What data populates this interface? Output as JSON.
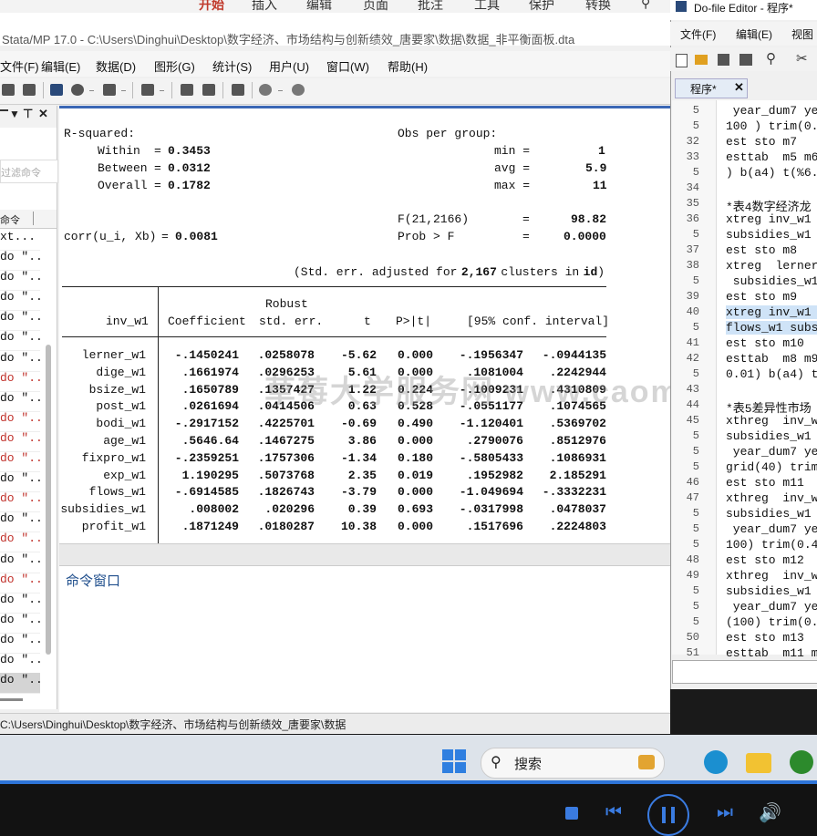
{
  "ribbon": {
    "items": [
      "开始",
      "插入",
      "编辑",
      "页面",
      "批注",
      "工具",
      "保护",
      "转换"
    ]
  },
  "stata": {
    "title": "Stata/MP 17.0 - C:\\Users\\Dinghui\\Desktop\\数字经济、市场结构与创新绩效_唐要家\\数据\\数据_非平衡面板.dta",
    "menu": [
      "文件(F)",
      "编辑(E)",
      "数据(D)",
      "图形(G)",
      "统计(S)",
      "用户(U)",
      "窗口(W)",
      "帮助(H)"
    ],
    "left_pane": {
      "filter_placeholder": "过滤命令",
      "col_header": "命令",
      "first_row": "xt...",
      "rows": [
        {
          "text": "do \"...",
          "color": "black"
        },
        {
          "text": "do \"...",
          "color": "black"
        },
        {
          "text": "do \"...",
          "color": "black"
        },
        {
          "text": "do \"...",
          "color": "black"
        },
        {
          "text": "do \"...",
          "color": "black"
        },
        {
          "text": "do \"...",
          "color": "black"
        },
        {
          "text": "do \"...",
          "color": "red"
        },
        {
          "text": "do \"...",
          "color": "black"
        },
        {
          "text": "do \"...",
          "color": "red"
        },
        {
          "text": "do \"...",
          "color": "red"
        },
        {
          "text": "do \"...",
          "color": "red"
        },
        {
          "text": "do \"...",
          "color": "black"
        },
        {
          "text": "do \"...",
          "color": "red"
        },
        {
          "text": "do \"...",
          "color": "black"
        },
        {
          "text": "do \"...",
          "color": "red"
        },
        {
          "text": "do \"...",
          "color": "black"
        },
        {
          "text": "do \"...",
          "color": "red"
        },
        {
          "text": "do \"...",
          "color": "black"
        },
        {
          "text": "do \"...",
          "color": "black"
        },
        {
          "text": "do \"...",
          "color": "black"
        },
        {
          "text": "do \"...",
          "color": "black"
        },
        {
          "text": "do \"...",
          "color": "selected"
        }
      ]
    },
    "results": {
      "rsq_label": "R-squared:",
      "within_label": "Within",
      "within": "0.3453",
      "between_label": "Between",
      "between": "0.0312",
      "overall_label": "Overall",
      "overall": "0.1782",
      "obs_label": "Obs per group:",
      "min_label": "min =",
      "min": "1",
      "avg_label": "avg =",
      "avg": "5.9",
      "max_label": "max =",
      "max": "11",
      "ftest_label": "F(21,2166)",
      "ftest": "98.82",
      "corr_label": "corr(u_i, Xb)",
      "corr": "0.0081",
      "prob_label": "Prob > F",
      "prob": "0.0000",
      "note_prefix": "(Std. err. adjusted for",
      "note_clusters": "2,167",
      "note_mid": "clusters in",
      "note_var": "id",
      "note_suffix": ")",
      "robust_label": "Robust",
      "depvar": "inv_w1",
      "col_coef": "Coefficient",
      "col_se": "std. err.",
      "col_t": "t",
      "col_p": "P>|t|",
      "col_ci": "[95% conf. interval]",
      "rows": [
        [
          "lerner_w1",
          "-.1450241",
          ".0258078",
          "-5.62",
          "0.000",
          "-.1956347",
          "-.0944135"
        ],
        [
          "dige_w1",
          ".1661974",
          ".0296253",
          "5.61",
          "0.000",
          ".1081004",
          ".2242944"
        ],
        [
          "bsize_w1",
          ".1650789",
          ".1357427",
          "1.22",
          "0.224",
          "-.1009231",
          ".4310809"
        ],
        [
          "post_w1",
          ".0261694",
          ".0414506",
          "0.63",
          "0.528",
          "-.0551177",
          ".1074565"
        ],
        [
          "bodi_w1",
          "-.2917152",
          ".4225701",
          "-0.69",
          "0.490",
          "-1.120401",
          ".5369702"
        ],
        [
          "age_w1",
          ".5646.64",
          ".1467275",
          "3.86",
          "0.000",
          ".2790076",
          ".8512976"
        ],
        [
          "fixpro_w1",
          "-.2359251",
          ".1757306",
          "-1.34",
          "0.180",
          "-.5805433",
          ".1086931"
        ],
        [
          "exp_w1",
          "1.190295",
          ".5073768",
          "2.35",
          "0.019",
          ".1952982",
          "2.185291"
        ],
        [
          "flows_w1",
          "-.6914585",
          ".1826743",
          "-3.79",
          "0.000",
          "-1.049694",
          "-.3332231"
        ],
        [
          "subsidies_w1",
          ".008002",
          ".020296",
          "0.39",
          "0.693",
          "-.0317998",
          ".0478037"
        ],
        [
          "profit_w1",
          ".1871249",
          ".0180287",
          "10.38",
          "0.000",
          ".1517696",
          ".2224803"
        ]
      ]
    },
    "command_window_label": "命令窗口",
    "status_path": "C:\\Users\\Dinghui\\Desktop\\数字经济、市场结构与创新绩效_唐要家\\数据"
  },
  "dofile": {
    "title": "Do-file Editor - 程序*",
    "menu": [
      "文件(F)",
      "编辑(E)",
      "视图"
    ],
    "tab_label": "程序*",
    "lines": [
      {
        "n": "5",
        "text": " year_dum7 ye",
        "hl": false
      },
      {
        "n": "5",
        "text": "100 ) trim(0.",
        "hl": false
      },
      {
        "n": "32",
        "text": "est sto m7",
        "hl": false
      },
      {
        "n": "33",
        "text": "esttab  m5 m6",
        "hl": false
      },
      {
        "n": "5",
        "text": ") b(a4) t(%6.",
        "hl": false
      },
      {
        "n": "34",
        "text": "",
        "hl": false
      },
      {
        "n": "35",
        "text": "*表4数字经济龙",
        "hl": false
      },
      {
        "n": "36",
        "text": "xtreg inv_w1",
        "hl": false
      },
      {
        "n": "5",
        "text": "subsidies_w1",
        "hl": false
      },
      {
        "n": "37",
        "text": "est sto m8",
        "hl": false
      },
      {
        "n": "38",
        "text": "xtreg  lerner",
        "hl": false
      },
      {
        "n": "5",
        "text": " subsidies_w1",
        "hl": false
      },
      {
        "n": "39",
        "text": "est sto m9",
        "hl": false
      },
      {
        "n": "40",
        "text": "xtreg inv_w1 ",
        "hl": true
      },
      {
        "n": "5",
        "text": "flows_w1 subs",
        "hl": true
      },
      {
        "n": "41",
        "text": "est sto m10",
        "hl": false
      },
      {
        "n": "42",
        "text": "esttab  m8 m9",
        "hl": false
      },
      {
        "n": "5",
        "text": "0.01) b(a4) t",
        "hl": false
      },
      {
        "n": "43",
        "text": "",
        "hl": false
      },
      {
        "n": "44",
        "text": "*表5差异性市场",
        "hl": false
      },
      {
        "n": "45",
        "text": "xthreg  inv_w",
        "hl": false
      },
      {
        "n": "5",
        "text": "subsidies_w1",
        "hl": false
      },
      {
        "n": "5",
        "text": " year_dum7 ye",
        "hl": false
      },
      {
        "n": "5",
        "text": "grid(40) trim",
        "hl": false
      },
      {
        "n": "46",
        "text": "est sto m11",
        "hl": false
      },
      {
        "n": "47",
        "text": "xthreg  inv_w",
        "hl": false
      },
      {
        "n": "5",
        "text": "subsidies_w1",
        "hl": false
      },
      {
        "n": "5",
        "text": " year_dum7 ye",
        "hl": false
      },
      {
        "n": "5",
        "text": "100) trim(0.4",
        "hl": false
      },
      {
        "n": "48",
        "text": "est sto m12",
        "hl": false
      },
      {
        "n": "49",
        "text": "xthreg  inv_w",
        "hl": false
      },
      {
        "n": "5",
        "text": "subsidies_w1",
        "hl": false
      },
      {
        "n": "5",
        "text": " year_dum7 ye",
        "hl": false
      },
      {
        "n": "5",
        "text": "(100) trim(0.",
        "hl": false
      },
      {
        "n": "50",
        "text": "est sto m13",
        "hl": false
      },
      {
        "n": "51",
        "text": "esttab  m11 m",
        "hl": false
      }
    ]
  },
  "taskbar": {
    "search_label": "搜索"
  },
  "watermark": "草莓大学服务网 www.caomeikeji.com"
}
